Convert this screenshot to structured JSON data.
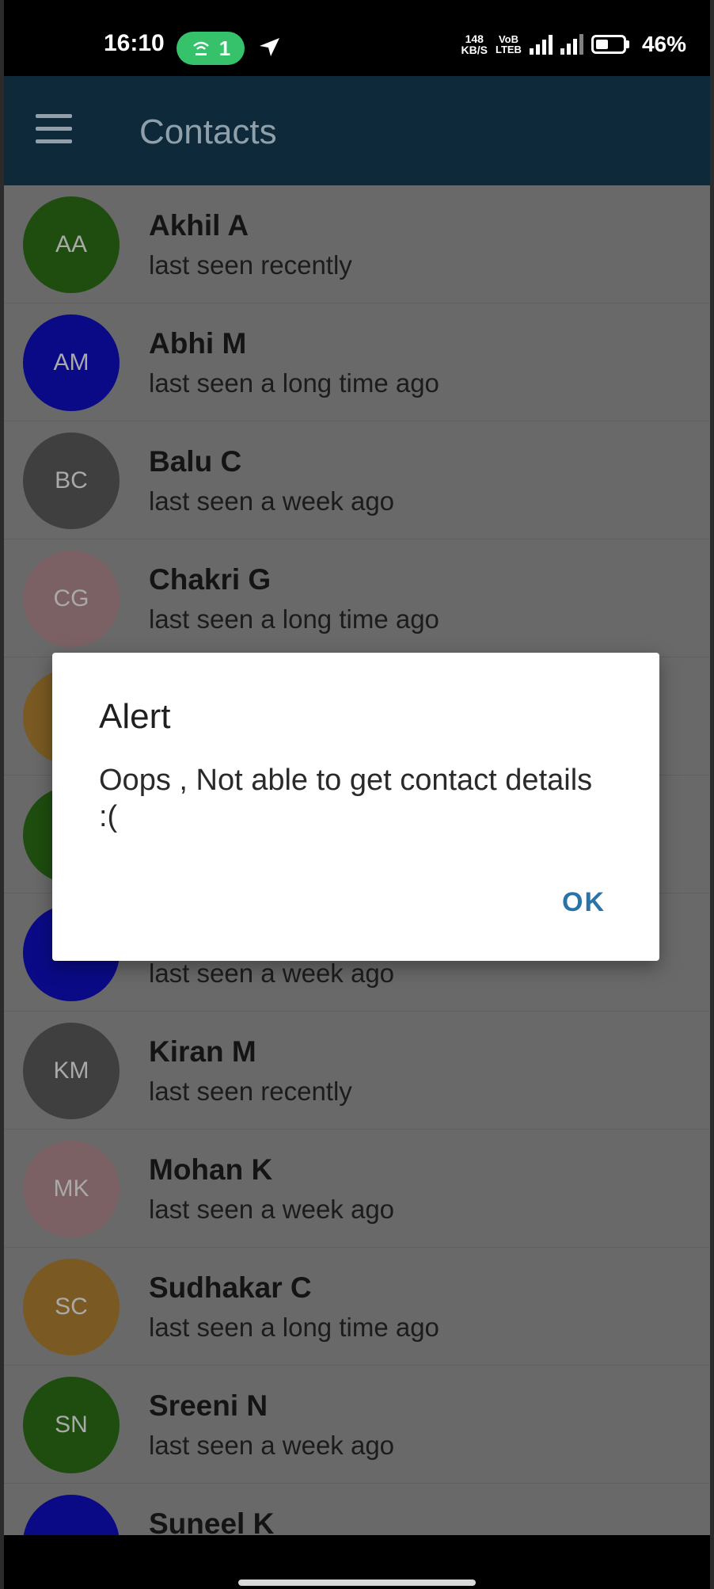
{
  "status_bar": {
    "time": "16:10",
    "hotspot_count": "1",
    "net_speed_top": "148",
    "net_speed_unit": "KB/S",
    "volte_top": "VoB",
    "volte_bottom": "LTEB",
    "battery_level": 0.46,
    "battery_pct": "46%"
  },
  "app_bar": {
    "title": "Contacts",
    "color": "#0e2a3a"
  },
  "contacts": [
    {
      "initials": "AA",
      "name": "Akhil A",
      "status": "last seen recently",
      "color": "#1e4d0f"
    },
    {
      "initials": "AM",
      "name": "Abhi M",
      "status": "last seen a long time ago",
      "color": "#0a0a87"
    },
    {
      "initials": "BC",
      "name": "Balu C",
      "status": "last seen a week ago",
      "color": "#3f3f3f"
    },
    {
      "initials": "CG",
      "name": "Chakri G",
      "status": "last seen a long time ago",
      "color": "#7b6164"
    },
    {
      "initials": "",
      "name": "",
      "status": "",
      "color": "#7a5a22"
    },
    {
      "initials": "",
      "name": "",
      "status": "",
      "color": "#1e4d0f"
    },
    {
      "initials": "",
      "name": "",
      "status": "last seen a week ago",
      "color": "#0a0a87"
    },
    {
      "initials": "KM",
      "name": "Kiran M",
      "status": "last seen recently",
      "color": "#3f3f3f"
    },
    {
      "initials": "MK",
      "name": "Mohan K",
      "status": "last seen a week ago",
      "color": "#7b6164"
    },
    {
      "initials": "SC",
      "name": "Sudhakar C",
      "status": "last seen a long time ago",
      "color": "#7a5a22"
    },
    {
      "initials": "SN",
      "name": "Sreeni N",
      "status": "last seen a week ago",
      "color": "#1e4d0f"
    },
    {
      "initials": "",
      "name": "Suneel K",
      "status": "",
      "color": "#0a0a87"
    }
  ],
  "dialog": {
    "title": "Alert",
    "message": "Oops , Not able to get contact details :(",
    "ok_label": "OK"
  }
}
